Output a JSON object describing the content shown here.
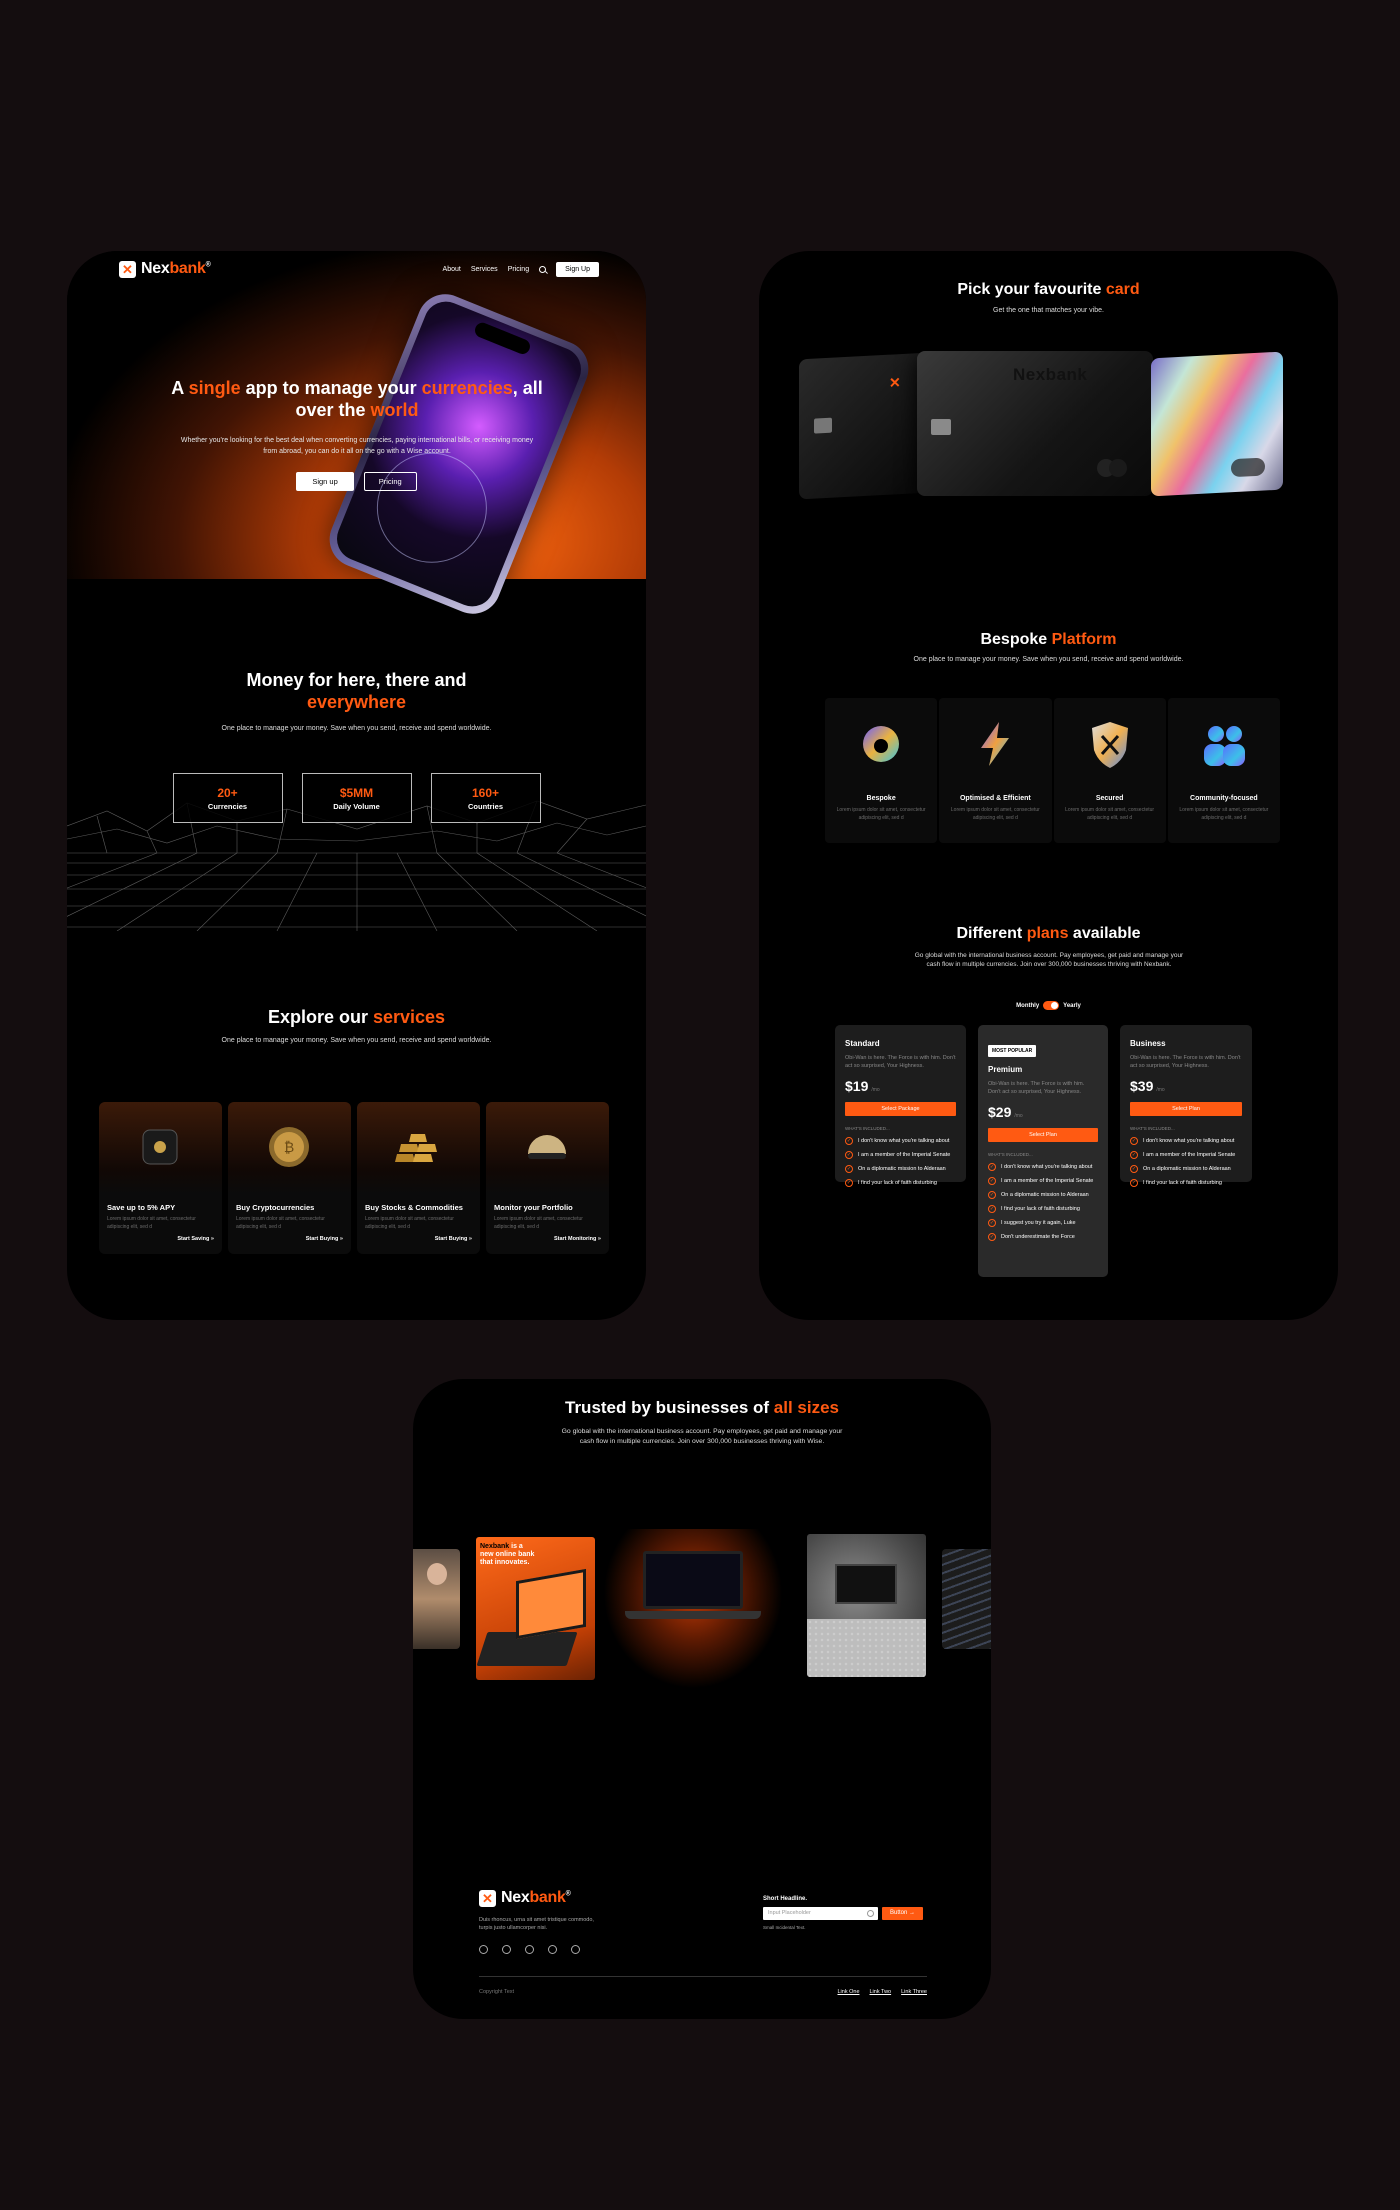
{
  "brand": {
    "name_a": "Nex",
    "name_b": "bank",
    "reg": "®",
    "mark": "✕"
  },
  "nav": {
    "about": "About",
    "services": "Services",
    "pricing": "Pricing",
    "signup": "Sign Up"
  },
  "hero": {
    "title_1": "A ",
    "title_2": "single",
    "title_3": " app to manage your ",
    "title_4": "currencies",
    "title_5": ", all over the ",
    "title_6": "world",
    "subtitle": "Whether you're looking for the best deal when converting currencies, paying international bills, or receiving money from abroad, you can do it all on the go with a Wise account.",
    "btn_signup": "Sign up",
    "btn_pricing": "Pricing"
  },
  "money": {
    "title_1": "Money for here, there and",
    "title_2": "everywhere",
    "subtitle": "One place to manage your money. Save when you send, receive and spend worldwide.",
    "stats": [
      {
        "value": "20+",
        "label": "Currencies"
      },
      {
        "value": "$5MM",
        "label": "Daily Volume"
      },
      {
        "value": "160+",
        "label": "Countries"
      }
    ]
  },
  "services": {
    "title_1": "Explore our ",
    "title_2": "services",
    "subtitle": "One place to manage your money. Save when you send, receive and spend worldwide.",
    "items": [
      {
        "title": "Save up to 5% APY",
        "desc": "Lorem ipsum dolor sit amet, consectetur adipiscing elit, sed d",
        "link": "Start Saving »"
      },
      {
        "title": "Buy Cryptocurrencies",
        "desc": "Lorem ipsum dolor sit amet, consectetur adipiscing elit, sed d",
        "link": "Start Buying »"
      },
      {
        "title": "Buy Stocks & Commodities",
        "desc": "Lorem ipsum dolor sit amet, consectetur adipiscing elit, sed d",
        "link": "Start Buying »"
      },
      {
        "title": "Monitor your Portfolio",
        "desc": "Lorem ipsum dolor sit amet, consectetur adipiscing elit, sed d",
        "link": "Start Monitoring »"
      }
    ]
  },
  "cards_section": {
    "title_1": "Pick your favourite ",
    "title_2": "card",
    "subtitle": "Get the one that matches your vibe.",
    "card_text": "Nexbank"
  },
  "platform": {
    "title_1": "Bespoke ",
    "title_2": "Platform",
    "subtitle": "One place to manage your money. Save when you send, receive and spend worldwide.",
    "items": [
      {
        "title": "Bespoke",
        "desc": "Lorem ipsum dolor sit amet, consectetur adipiscing elit, sed d"
      },
      {
        "title": "Optimised & Efficient",
        "desc": "Lorem ipsum dolor sit amet, consectetur adipiscing elit, sed d"
      },
      {
        "title": "Secured",
        "desc": "Lorem ipsum dolor sit amet, consectetur adipiscing elit, sed d"
      },
      {
        "title": "Community-focused",
        "desc": "Lorem ipsum dolor sit amet, consectetur adipiscing elit, sed d"
      }
    ]
  },
  "plans": {
    "title_1": "Different ",
    "title_2": "plans",
    "title_3": " available",
    "subtitle": "Go global with the international business account. Pay employees, get paid and manage your cash flow in multiple currencies. Join over 300,000 businesses thriving with Nexbank.",
    "monthly": "Monthly",
    "yearly": "Yearly",
    "standard": {
      "name": "Standard",
      "desc": "Obi-Wan is here. The Force is with him. Don't act so surprised, Your Highness.",
      "price": "$19",
      "per": "/mo",
      "button": "Select Package",
      "included": "WHAT'S INCLUDED...",
      "features": [
        "I don't know what you're talking about",
        "I am a member of the Imperial Senate",
        "On a diplomatic mission to Alderaan",
        "I find your lack of faith disturbing"
      ]
    },
    "premium": {
      "badge": "MOST POPULAR",
      "name": "Premium",
      "desc": "Obi-Wan is here. The Force is with him. Don't act so surprised, Your Highness.",
      "price": "$29",
      "per": "/mo",
      "button": "Select Plan",
      "included": "WHAT'S INCLUDED...",
      "features": [
        "I don't know what you're talking about",
        "I am a member of the Imperial Senate",
        "On a diplomatic mission to Alderaan",
        "I find your lack of faith disturbing",
        "I suggest you try it again, Luke",
        "Don't underestimate the Force"
      ]
    },
    "business": {
      "name": "Business",
      "desc": "Obi-Wan is here. The Force is with him. Don't act so surprised, Your Highness.",
      "price": "$39",
      "per": "/mo",
      "button": "Select Plan",
      "included": "WHAT'S INCLUDED...",
      "features": [
        "I don't know what you're talking about",
        "I am a member of the Imperial Senate",
        "On a diplomatic mission to Alderaan",
        "I find your lack of faith disturbing"
      ]
    }
  },
  "trusted": {
    "title_1": "Trusted by businesses of ",
    "title_2": "all sizes",
    "subtitle": "Go global with the international business account. Pay employees, get paid and manage your cash flow in multiple currencies. Join over 300,000 businesses thriving with Wise.",
    "promo_1": "Nexbank",
    "promo_2": " is a new online bank that innovates."
  },
  "footer": {
    "tagline": "Duis rhoncus, urna sit amet tristique commodo, turpis justo ullamcorper nisi.",
    "headline": "Short Headline.",
    "placeholder": "Input Placeholder",
    "button": "Button",
    "help": "Small Incidental Text.",
    "copyright": "Copyright Text",
    "links": [
      "Link One",
      "Link Two",
      "Link Three"
    ]
  },
  "colors": {
    "accent": "#ff5a12",
    "background": "#140d0f",
    "panel": "#000000"
  }
}
